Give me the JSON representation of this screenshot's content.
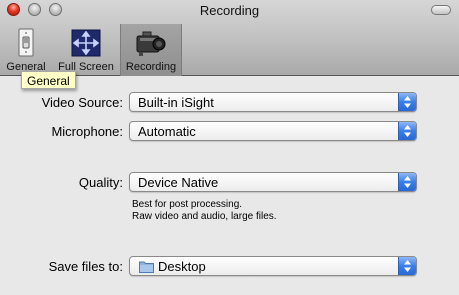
{
  "window": {
    "title": "Recording"
  },
  "toolbar": {
    "items": [
      {
        "label": "General",
        "icon": "light-switch-icon",
        "selected": false
      },
      {
        "label": "Full Screen",
        "icon": "fullscreen-arrows-icon",
        "selected": false
      },
      {
        "label": "Recording",
        "icon": "video-camera-icon",
        "selected": true
      }
    ]
  },
  "tooltip": {
    "text": "General"
  },
  "form": {
    "video_source": {
      "label": "Video Source:",
      "value": "Built-in iSight"
    },
    "microphone": {
      "label": "Microphone:",
      "value": "Automatic"
    },
    "quality": {
      "label": "Quality:",
      "value": "Device Native",
      "hint_line1": "Best for post processing.",
      "hint_line2": "Raw video and audio, large files."
    },
    "save_files_to": {
      "label": "Save files to:",
      "value": "Desktop",
      "icon": "folder-icon"
    }
  },
  "colors": {
    "close_button": "#e33a26",
    "popup_arrows": "#3b7ee6",
    "tooltip_bg": "#ffffc7"
  }
}
